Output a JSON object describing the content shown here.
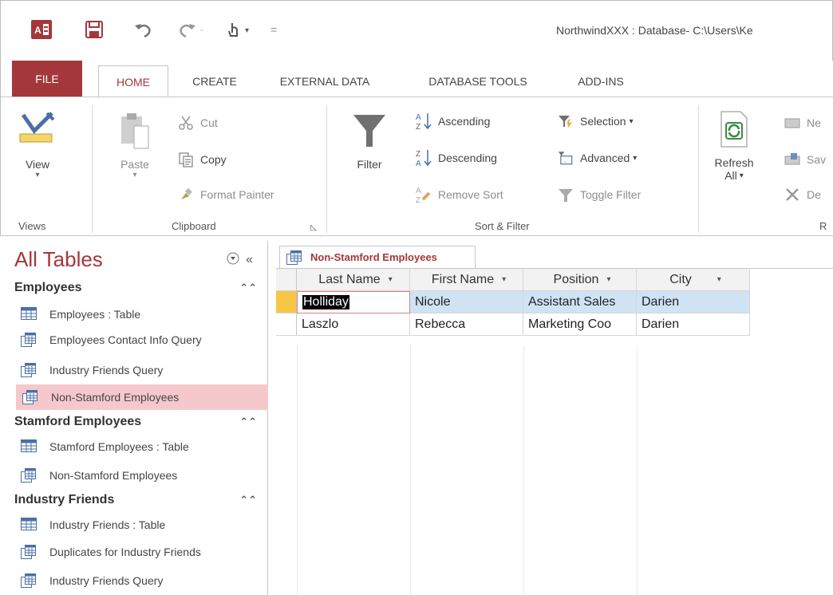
{
  "title_bar": {
    "title": "NorthwindXXX : Database- C:\\Users\\Ke",
    "qat_customize": "="
  },
  "tabs": [
    {
      "label": "FILE"
    },
    {
      "label": "HOME"
    },
    {
      "label": "CREATE"
    },
    {
      "label": "EXTERNAL DATA"
    },
    {
      "label": "DATABASE TOOLS"
    },
    {
      "label": "ADD-INS"
    }
  ],
  "ribbon": {
    "views": {
      "view_label": "View",
      "group_label": "Views"
    },
    "clipboard": {
      "paste_label": "Paste",
      "cut_label": "Cut",
      "copy_label": "Copy",
      "format_painter_label": "Format Painter",
      "group_label": "Clipboard"
    },
    "sort_filter": {
      "filter_label": "Filter",
      "ascending_label": "Ascending",
      "descending_label": "Descending",
      "remove_sort_label": "Remove Sort",
      "selection_label": "Selection",
      "advanced_label": "Advanced",
      "toggle_filter_label": "Toggle Filter",
      "group_label": "Sort & Filter"
    },
    "records": {
      "refresh_label": "Refresh",
      "refresh_all_label": "All",
      "new_label": "Ne",
      "save_label": "Sav",
      "delete_label": "De",
      "group_label": "R"
    }
  },
  "nav_pane": {
    "title": "All Tables",
    "groups": [
      {
        "name": "Employees",
        "items": [
          {
            "label": "Employees : Table",
            "type": "table"
          },
          {
            "label": "Employees Contact Info Query",
            "type": "query"
          },
          {
            "label": "Industry Friends Query",
            "type": "query"
          },
          {
            "label": "Non-Stamford Employees",
            "type": "query",
            "selected": true
          }
        ]
      },
      {
        "name": "Stamford Employees",
        "items": [
          {
            "label": "Stamford Employees : Table",
            "type": "table"
          },
          {
            "label": "Non-Stamford Employees",
            "type": "query"
          }
        ]
      },
      {
        "name": "Industry Friends",
        "items": [
          {
            "label": "Industry Friends : Table",
            "type": "table"
          },
          {
            "label": "Duplicates for Industry Friends",
            "type": "query"
          },
          {
            "label": "Industry Friends Query",
            "type": "query"
          }
        ]
      }
    ]
  },
  "document": {
    "tab_label": "Non-Stamford Employees",
    "columns": [
      "Last Name",
      "First Name",
      "Position",
      "City"
    ],
    "rows": [
      [
        "Holliday",
        "Nicole",
        "Assistant Sales",
        "Darien"
      ],
      [
        "Laszlo",
        "Rebecca",
        "Marketing Coo",
        "Darien"
      ]
    ]
  },
  "colors": {
    "accent": "#a4373a",
    "selected_nav": "#f5c9cb",
    "current_row": "#cfe3f5",
    "record_selector": "#f7c644"
  }
}
